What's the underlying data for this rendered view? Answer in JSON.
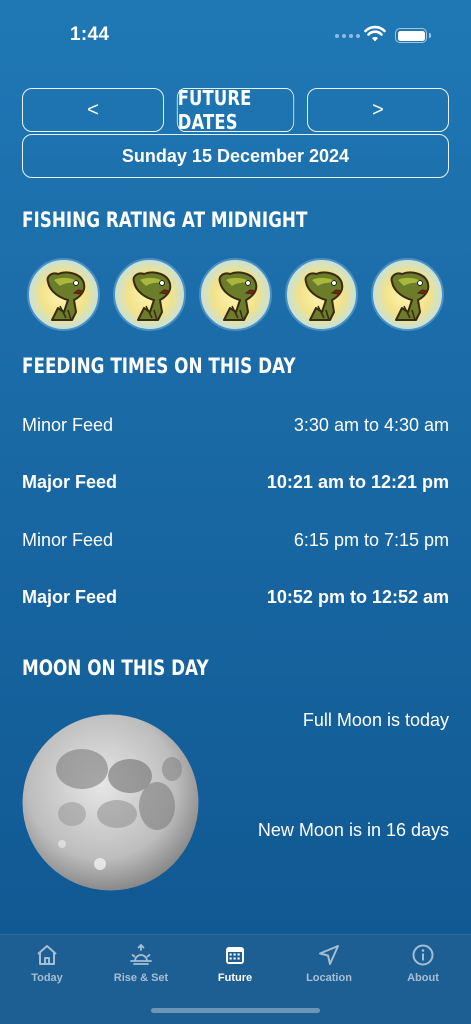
{
  "status_bar": {
    "time": "1:44"
  },
  "nav": {
    "prev_label": "<",
    "title": "FUTURE DATES",
    "next_label": ">"
  },
  "date": "Sunday 15 December 2024",
  "rating": {
    "heading": "FISHING RATING AT MIDNIGHT",
    "fish_count": 5,
    "icon": "bass-fish-icon"
  },
  "feeding": {
    "heading": "FEEDING TIMES ON THIS DAY",
    "rows": [
      {
        "label": "Minor Feed",
        "time": "3:30 am to 4:30 am",
        "type": "minor"
      },
      {
        "label": "Major Feed",
        "time": "10:21 am to 12:21 pm",
        "type": "major"
      },
      {
        "label": "Minor Feed",
        "time": "6:15 pm to 7:15 pm",
        "type": "minor"
      },
      {
        "label": "Major Feed",
        "time": "10:52 pm to 12:52 am",
        "type": "major"
      }
    ]
  },
  "moon": {
    "heading": "MOON ON THIS DAY",
    "full_moon_text": "Full Moon is today",
    "new_moon_text": "New Moon is in 16 days"
  },
  "tabs": [
    {
      "label": "Today",
      "icon": "house-icon"
    },
    {
      "label": "Rise & Set",
      "icon": "sunrise-icon"
    },
    {
      "label": "Future",
      "icon": "calendar-icon",
      "active": true
    },
    {
      "label": "Location",
      "icon": "location-arrow-icon"
    },
    {
      "label": "About",
      "icon": "info-icon"
    }
  ]
}
